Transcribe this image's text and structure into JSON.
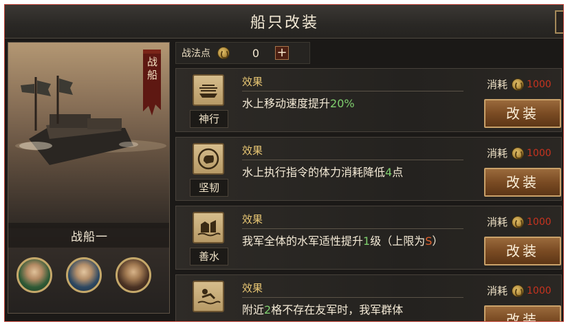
{
  "window": {
    "title": "船只改装"
  },
  "ship": {
    "type_label": "战船",
    "name": "战船一",
    "portraits": [
      {
        "icon": "general-portrait-green-icon"
      },
      {
        "icon": "general-portrait-blue-icon"
      },
      {
        "icon": "general-portrait-bearded-icon"
      }
    ]
  },
  "points": {
    "label": "战法点",
    "value": "0",
    "plus_label": "+"
  },
  "modifications": [
    {
      "name": "神行",
      "icon": "boat-speed-icon",
      "effect_title": "效果",
      "desc_parts": [
        "水上移动速度提升",
        "20%",
        ""
      ],
      "cost_label": "消耗",
      "cost_value": "1000",
      "button_label": "改装"
    },
    {
      "name": "坚韧",
      "icon": "fist-icon",
      "effect_title": "效果",
      "desc_parts": [
        "水上执行指令的体力消耗降低",
        "4",
        "点"
      ],
      "cost_label": "消耗",
      "cost_value": "1000",
      "button_label": "改装"
    },
    {
      "name": "善水",
      "icon": "water-fortress-icon",
      "effect_title": "效果",
      "desc_parts": [
        "我军全体的水军适性提升",
        "1",
        "级（上限为",
        "S",
        "）"
      ],
      "cost_label": "消耗",
      "cost_value": "1000",
      "button_label": "改装"
    },
    {
      "name": "",
      "icon": "swimmer-icon",
      "effect_title": "效果",
      "desc_parts": [
        "附近",
        "2",
        "格不存在友军时，我军群体"
      ],
      "cost_label": "消耗",
      "cost_value": "1000",
      "button_label": "改装"
    }
  ],
  "colors": {
    "accent_gold": "#e9c774",
    "value_green": "#7fcf6e",
    "cost_red": "#c8331f",
    "grade_orange": "#e2622e"
  }
}
